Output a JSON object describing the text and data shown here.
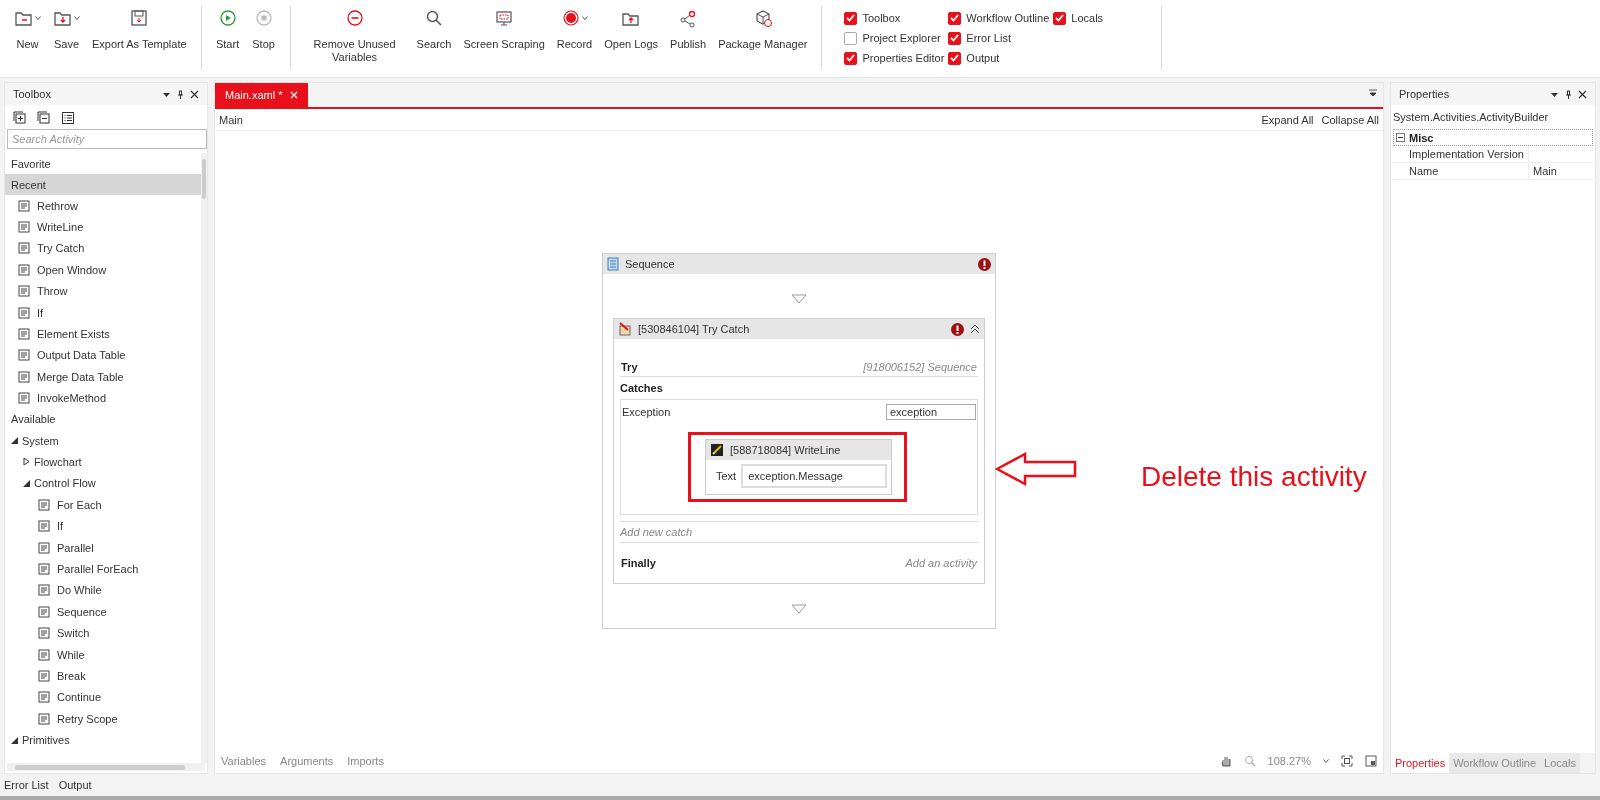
{
  "toolbar": {
    "groups": [
      [
        {
          "label": "New",
          "dropdown": true
        },
        {
          "label": "Save",
          "dropdown": true
        },
        {
          "label": "Export As Template",
          "dropdown": false
        }
      ],
      [
        {
          "label": "Start",
          "dropdown": false,
          "disabled": false
        },
        {
          "label": "Stop",
          "dropdown": false,
          "disabled": true
        }
      ],
      [
        {
          "label": "Remove Unused Variables",
          "dropdown": false
        },
        {
          "label": "Search",
          "dropdown": false
        },
        {
          "label": "Screen Scraping",
          "dropdown": false
        },
        {
          "label": "Record",
          "dropdown": true
        },
        {
          "label": "Open Logs",
          "dropdown": false
        },
        {
          "label": "Publish",
          "dropdown": false
        },
        {
          "label": "Package Manager",
          "dropdown": false
        }
      ]
    ],
    "panel_toggles": [
      {
        "label": "Toolbox",
        "checked": true
      },
      {
        "label": "Project Explorer",
        "checked": false
      },
      {
        "label": "Properties Editor",
        "checked": true
      },
      {
        "label": "Workflow Outline",
        "checked": true
      },
      {
        "label": "Error List",
        "checked": true
      },
      {
        "label": "Output",
        "checked": true
      },
      {
        "label": "Locals",
        "checked": true
      }
    ]
  },
  "toolbox": {
    "title": "Toolbox",
    "search": {
      "placeholder": "Search Activity"
    },
    "categories": [
      {
        "label": "Favorite",
        "selected": false
      },
      {
        "label": "Recent",
        "selected": true,
        "items": [
          {
            "kind": "activity",
            "label": "Rethrow"
          },
          {
            "kind": "activity",
            "label": "WriteLine"
          },
          {
            "kind": "activity",
            "label": "Try Catch"
          },
          {
            "kind": "activity",
            "label": "Open Window"
          },
          {
            "kind": "activity",
            "label": "Throw"
          },
          {
            "kind": "activity",
            "label": "If"
          },
          {
            "kind": "activity",
            "label": "Element Exists"
          },
          {
            "kind": "activity",
            "label": "Output Data Table"
          },
          {
            "kind": "activity",
            "label": "Merge Data Table"
          },
          {
            "kind": "activity",
            "label": "InvokeMethod"
          }
        ]
      },
      {
        "label": "Available",
        "selected": false,
        "items": [
          {
            "kind": "folder",
            "label": "System",
            "expanded": true,
            "children": [
              {
                "kind": "folder",
                "label": "Flowchart",
                "expanded": false
              },
              {
                "kind": "folder",
                "label": "Control Flow",
                "expanded": true,
                "children": [
                  {
                    "kind": "activity",
                    "label": "For Each"
                  },
                  {
                    "kind": "activity",
                    "label": "If"
                  },
                  {
                    "kind": "activity",
                    "label": "Parallel"
                  },
                  {
                    "kind": "activity",
                    "label": "Parallel ForEach"
                  },
                  {
                    "kind": "activity",
                    "label": "Do While"
                  },
                  {
                    "kind": "activity",
                    "label": "Sequence"
                  },
                  {
                    "kind": "activity",
                    "label": "Switch"
                  },
                  {
                    "kind": "activity",
                    "label": "While"
                  },
                  {
                    "kind": "activity",
                    "label": "Break"
                  },
                  {
                    "kind": "activity",
                    "label": "Continue"
                  },
                  {
                    "kind": "activity",
                    "label": "Retry Scope"
                  }
                ]
              }
            ]
          },
          {
            "kind": "folder",
            "label": "Primitives",
            "expanded": true
          }
        ]
      }
    ]
  },
  "document_tabs": [
    {
      "label": "Main.xaml *",
      "selected": true
    }
  ],
  "breadcrumb": "Main",
  "expand_all": "Expand All",
  "collapse_all": "Collapse All",
  "sequence": {
    "title": "Sequence",
    "error": true,
    "try_catch": {
      "title": "[530846104] Try Catch",
      "error": true,
      "try_label": "Try",
      "try_value": "[918006152] Sequence",
      "catches_label": "Catches",
      "catch": {
        "exception_type": "Exception",
        "variable": "exception",
        "activity": {
          "title": "[588718084] WriteLine",
          "highlighted": true,
          "text_label": "Text",
          "text_value": "exception.Message"
        }
      },
      "add_catch": "Add new catch",
      "finally_label": "Finally",
      "finally_value": "Add an activity"
    }
  },
  "annotation": "Delete this activity",
  "designer_tabs": [
    "Variables",
    "Arguments",
    "Imports"
  ],
  "zoom": "108.27%",
  "properties": {
    "title": "Properties",
    "object": "System.Activities.ActivityBuilder",
    "category": {
      "label": "Misc",
      "expanded": true
    },
    "rows": [
      {
        "name": "Implementation Version"
      },
      {
        "name": "Name",
        "value": "Main"
      }
    ],
    "tabs": [
      {
        "label": "Properties",
        "selected": true
      },
      {
        "label": "Workflow Outline",
        "selected": false
      },
      {
        "label": "Locals",
        "selected": false
      }
    ]
  },
  "status_tabs": [
    "Error List",
    "Output"
  ]
}
